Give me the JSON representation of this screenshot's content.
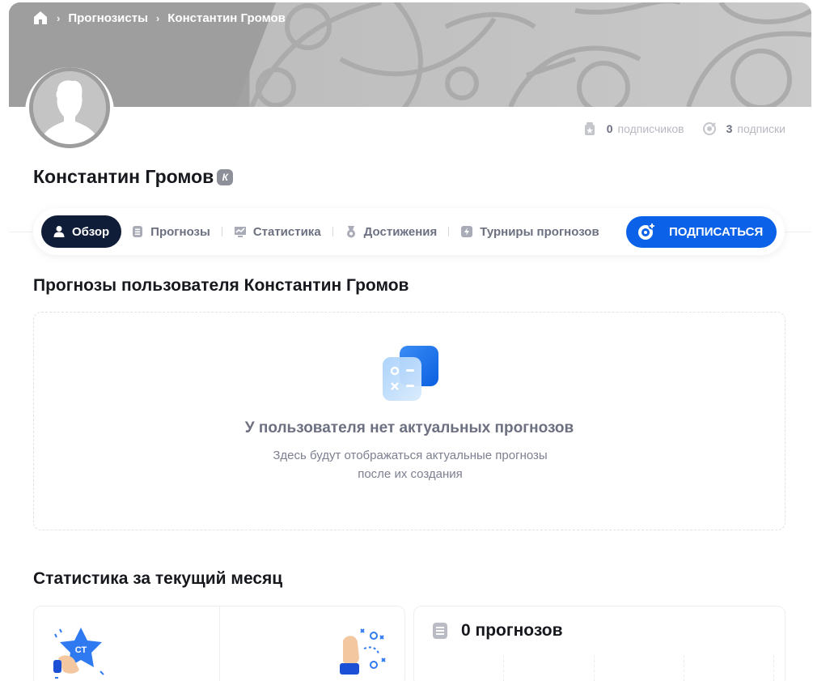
{
  "breadcrumb": {
    "items": [
      "Прогнозисты",
      "Константин Громов"
    ]
  },
  "profile": {
    "name": "Константин Громов",
    "badge": "К",
    "subscribers_count": "0",
    "subscribers_label": "подписчиков",
    "subscriptions_count": "3",
    "subscriptions_label": "подписки"
  },
  "tabs": [
    {
      "label": "Обзор",
      "icon": "user-icon",
      "active": true
    },
    {
      "label": "Прогнозы",
      "icon": "list-icon",
      "active": false
    },
    {
      "label": "Статистика",
      "icon": "chart-icon",
      "active": false
    },
    {
      "label": "Достижения",
      "icon": "medal-icon",
      "active": false
    },
    {
      "label": "Турниры прогнозов",
      "icon": "lightning-icon",
      "active": false
    }
  ],
  "subscribe_label": "ПОДПИСАТЬСЯ",
  "forecasts": {
    "heading": "Прогнозы пользователя Константин Громов",
    "empty_title": "У пользователя нет актуальных прогнозов",
    "empty_desc": "Здесь будут отображаться актуальные прогнозы после их создания"
  },
  "stats": {
    "heading": "Статистика за текущий месяц",
    "count_title": "0 прогнозов",
    "star_text": "СТ"
  },
  "colors": {
    "accent": "#0b62e8",
    "active_tab": "#0f1d38",
    "muted": "#6c7080"
  }
}
